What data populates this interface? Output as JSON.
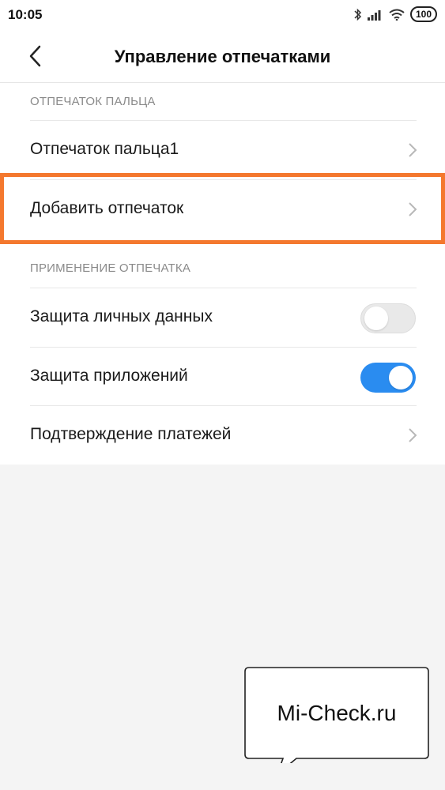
{
  "status_bar": {
    "time": "10:05",
    "battery": "100"
  },
  "header": {
    "title": "Управление отпечатками"
  },
  "sections": [
    {
      "header": "ОТПЕЧАТОК ПАЛЬЦА",
      "items": [
        {
          "label": "Отпечаток пальца1",
          "control": "chevron"
        },
        {
          "label": "Добавить отпечаток",
          "control": "chevron",
          "highlighted": true
        }
      ]
    },
    {
      "header": "ПРИМЕНЕНИЕ ОТПЕЧАТКА",
      "items": [
        {
          "label": "Защита личных данных",
          "control": "toggle",
          "state": "off"
        },
        {
          "label": "Защита приложений",
          "control": "toggle",
          "state": "on"
        },
        {
          "label": "Подтверждение платежей",
          "control": "chevron"
        }
      ]
    }
  ],
  "watermark": {
    "text": "Mi-Check.ru"
  },
  "colors": {
    "accent": "#2a8cf0",
    "highlight": "#f4782e",
    "background": "#f4f4f4"
  }
}
